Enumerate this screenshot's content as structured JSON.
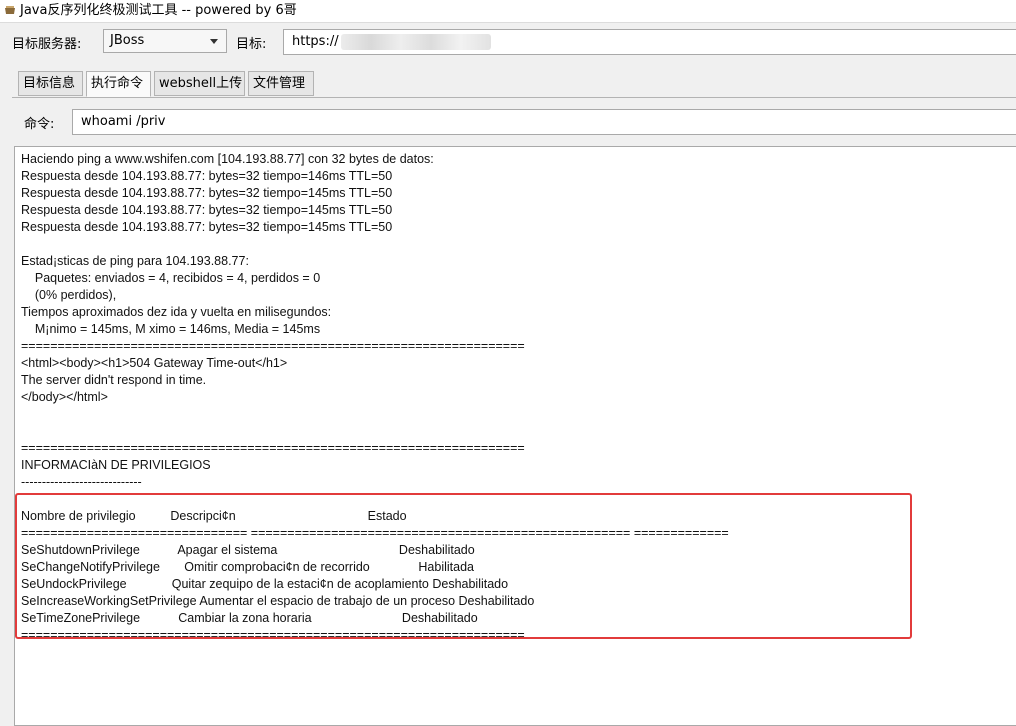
{
  "window": {
    "title": "Java反序列化终极测试工具  -- powered by 6哥",
    "icon": "app-icon"
  },
  "server": {
    "label": "目标服务器:",
    "selected": "JBoss"
  },
  "target": {
    "label": "目标:",
    "value": "https://"
  },
  "tabs": [
    {
      "label": "目标信息",
      "active": false
    },
    {
      "label": "执行命令",
      "active": true
    },
    {
      "label": "webshell上传",
      "active": false
    },
    {
      "label": "文件管理",
      "active": false
    }
  ],
  "command": {
    "label": "命令:",
    "value": "whoami /priv"
  },
  "output": {
    "text": "Haciendo ping a www.wshifen.com [104.193.88.77] con 32 bytes de datos:\nRespuesta desde 104.193.88.77: bytes=32 tiempo=146ms TTL=50\nRespuesta desde 104.193.88.77: bytes=32 tiempo=145ms TTL=50\nRespuesta desde 104.193.88.77: bytes=32 tiempo=145ms TTL=50\nRespuesta desde 104.193.88.77: bytes=32 tiempo=145ms TTL=50\n\nEstad¡sticas de ping para 104.193.88.77:\n    Paquetes: enviados = 4, recibidos = 4, perdidos = 0\n    (0% perdidos),\nTiempos aproximados dez ida y vuelta en milisegundos:\n    M¡nimo = 145ms, M ximo = 146ms, Media = 145ms\n=====================================================================\n<html><body><h1>504 Gateway Time-out</h1>\nThe server didn't respond in time.\n</body></html>\n\n\n=====================================================================\nINFORMACIàN DE PRIVILEGIOS\n-----------------------------\n\nNombre de privilegio          Descripci¢n                                      Estado\n=============================== ==================================================== =============\nSeShutdownPrivilege           Apagar el sistema                                   Deshabilitado\nSeChangeNotifyPrivilege       Omitir comprobaci¢n de recorrido              Habilitada\nSeUndockPrivilege             Quitar zequipo de la estaci¢n de acoplamiento Deshabilitado\nSeIncreaseWorkingSetPrivilege Aumentar el espacio de trabajo de un proceso Deshabilitado\nSeTimeZonePrivilege           Cambiar la zona horaria                          Deshabilitado\n====================================================================="
  },
  "colors": {
    "highlight": "#e23b3b"
  }
}
